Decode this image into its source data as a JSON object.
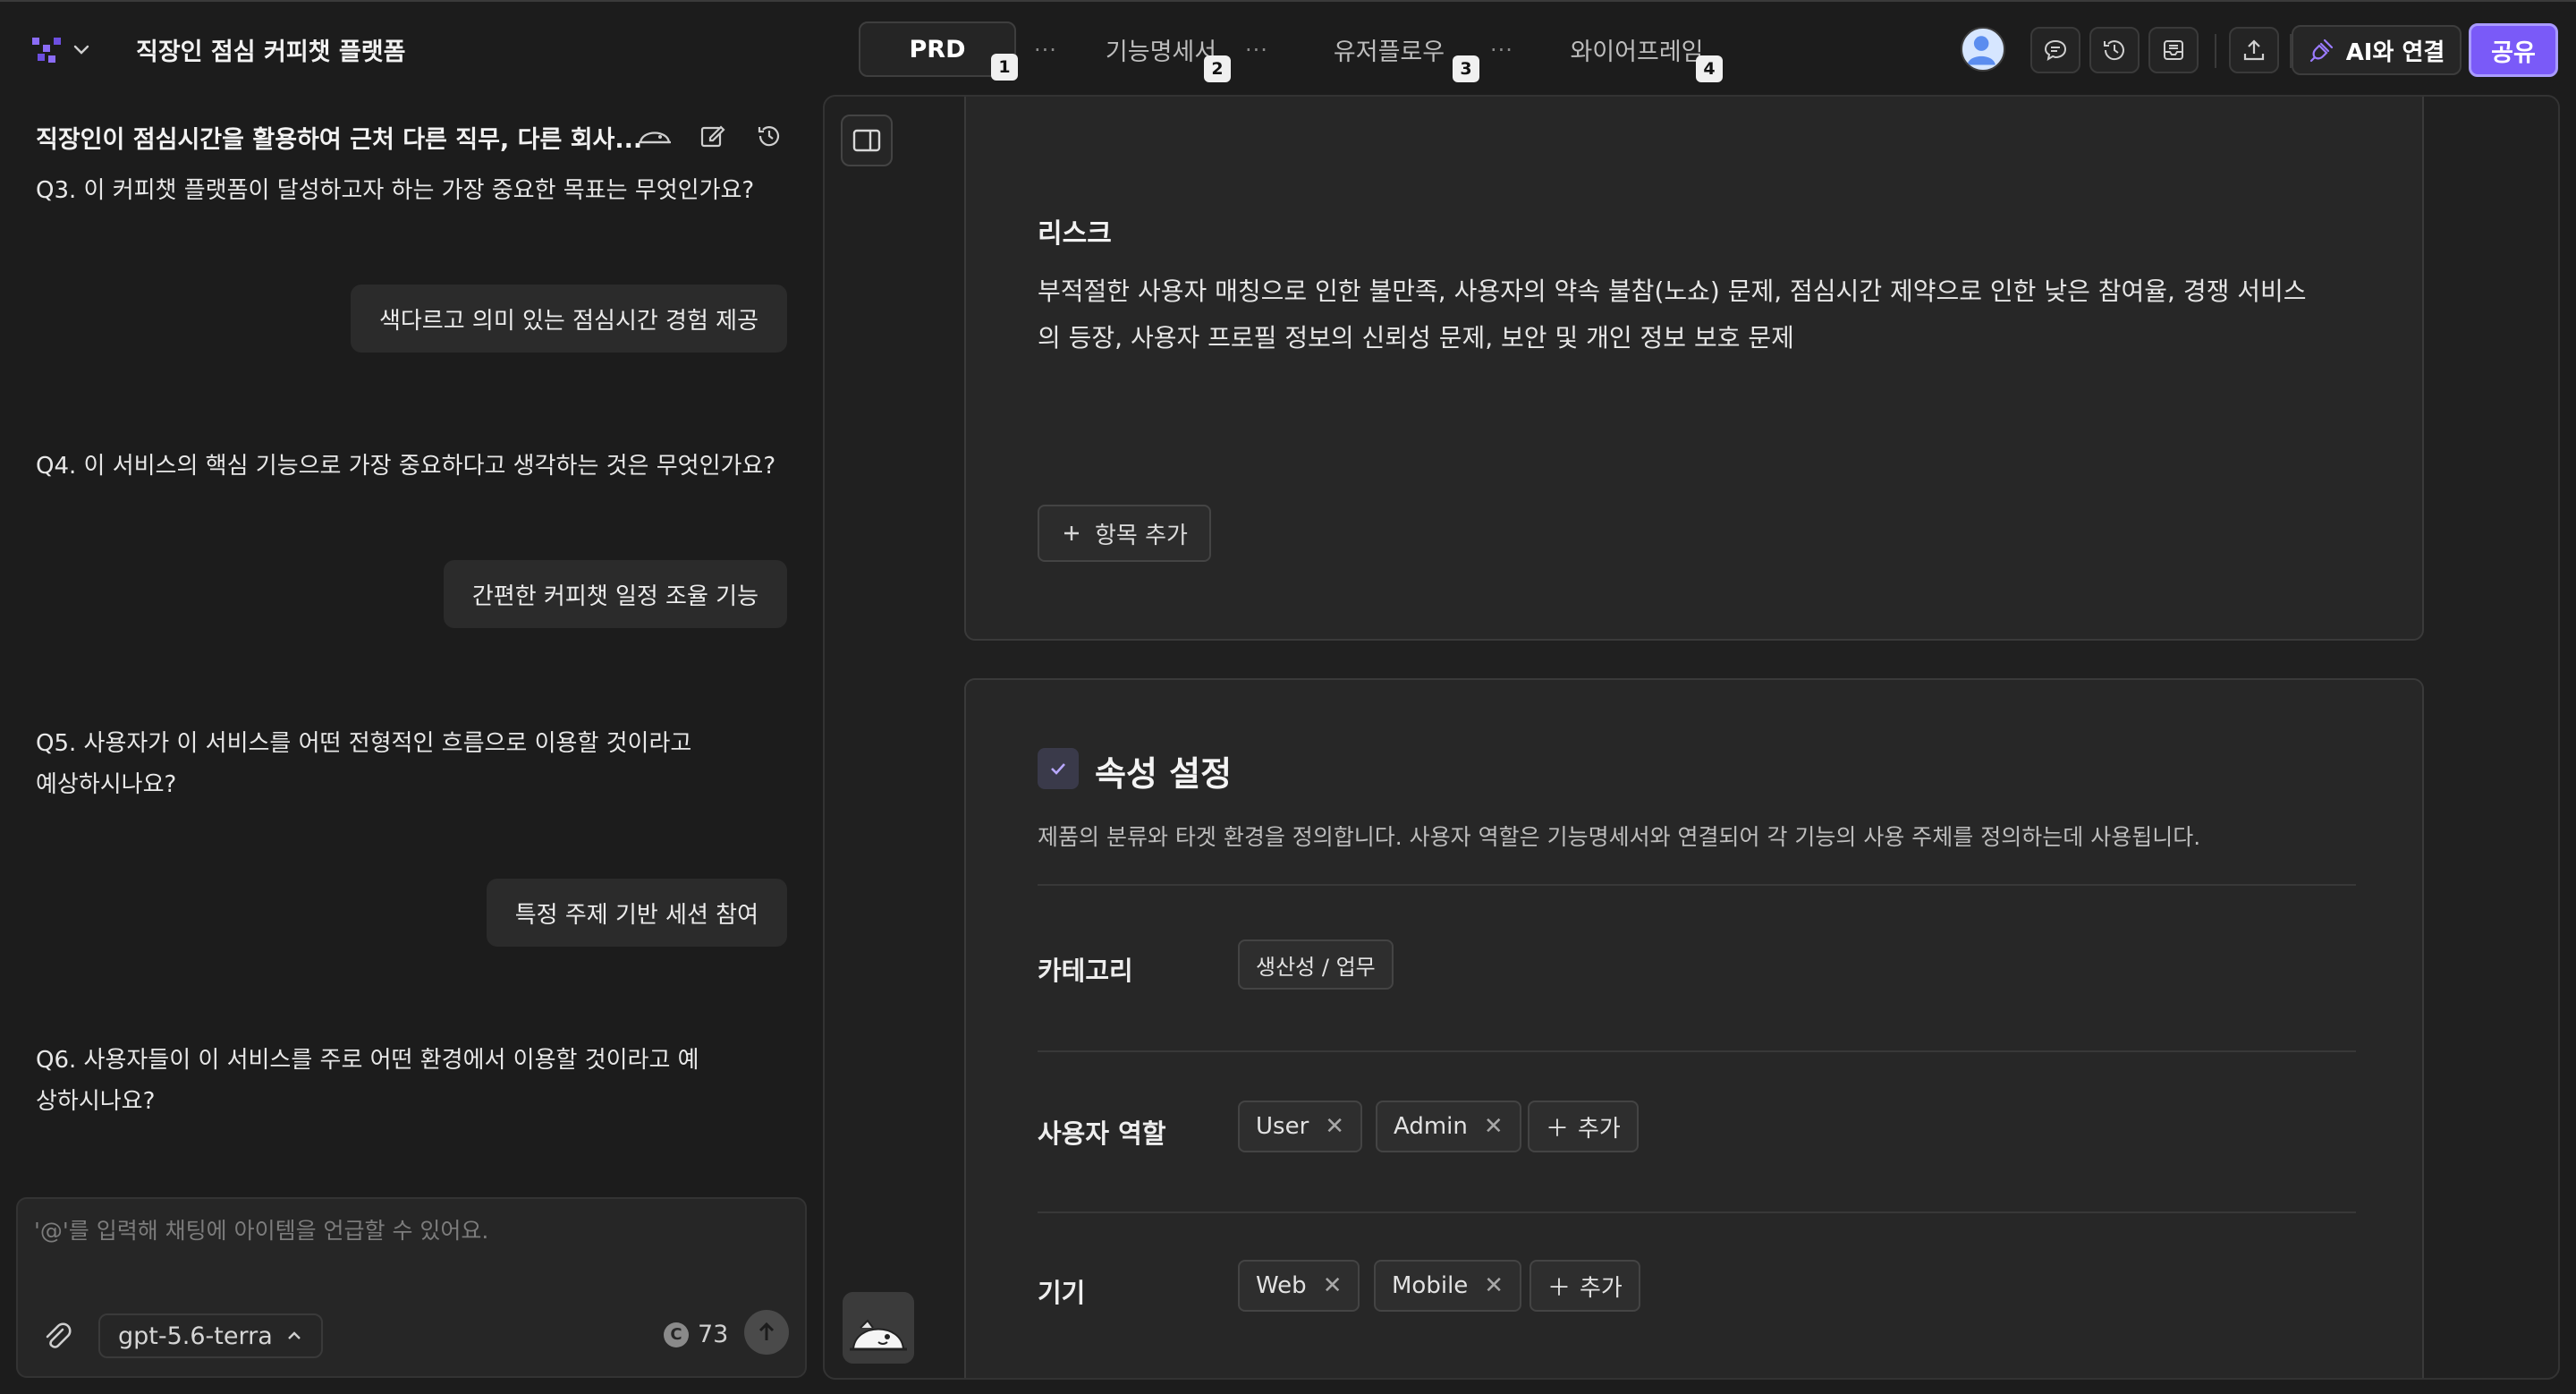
{
  "topbar": {
    "project_title": "직장인 점심 커피챗 플랫폼",
    "tabs": [
      {
        "label": "PRD",
        "num": "1"
      },
      {
        "label": "기능명세서",
        "num": "2"
      },
      {
        "label": "유저플로우",
        "num": "3"
      },
      {
        "label": "와이어프레임",
        "num": "4"
      }
    ],
    "ai_connect_label": "AI와 연결",
    "share_label": "공유"
  },
  "chat": {
    "header_title": "직장인이 점심시간을 활용하여 근처 다른 직무, 다른 회사...",
    "messages": [
      {
        "question": "Q3. 이 커피챗 플랫폼이 달성하고자 하는 가장 중요한 목표는 무엇인가요?",
        "answer": "색다르고 의미 있는 점심시간 경험 제공"
      },
      {
        "question": "Q4. 이 서비스의 핵심 기능으로 가장 중요하다고 생각하는 것은 무엇인가요?",
        "answer": "간편한 커피챗 일정 조율 기능"
      },
      {
        "question": "Q5. 사용자가 이 서비스를 어떤 전형적인 흐름으로 이용할 것이라고 예상하시나요?",
        "answer": "특정 주제 기반 세션 참여"
      },
      {
        "question": "Q6. 사용자들이 이 서비스를 주로 어떤 환경에서 이용할 것이라고 예상하시나요?"
      }
    ],
    "input_placeholder": "'@'를 입력해 채팅에 아이템을 언급할 수 있어요.",
    "model": "gpt-5.6-terra",
    "credits": "73"
  },
  "document": {
    "risk": {
      "title": "리스크",
      "text": "부적절한 사용자 매칭으로 인한 불만족, 사용자의 약속 불참(노쇼) 문제, 점심시간 제약으로 인한 낮은 참여율, 경쟁 서비스의 등장, 사용자 프로필 정보의 신뢰성 문제, 보안 및 개인 정보 보호 문제",
      "add_item_label": "항목 추가"
    },
    "attributes": {
      "title": "속성 설정",
      "description": "제품의 분류와 타겟 환경을 정의합니다. 사용자 역할은 기능명세서와 연결되어 각 기능의 사용 주체를 정의하는데 사용됩니다.",
      "category_label": "카테고리",
      "category_value": "생산성 / 업무",
      "roles_label": "사용자 역할",
      "roles": [
        "User",
        "Admin"
      ],
      "devices_label": "기기",
      "devices": [
        "Web",
        "Mobile"
      ],
      "add_label": "추가"
    }
  },
  "colors": {
    "background": "#1c1c1c",
    "card": "#272727",
    "accent": "#7a5af8"
  }
}
